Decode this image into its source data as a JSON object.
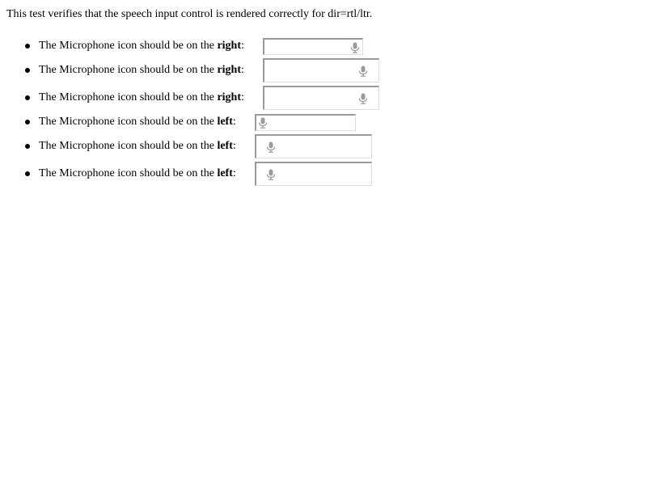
{
  "intro": "This test verifies that the speech input control is rendered correctly for dir=rtl/ltr.",
  "colors": {
    "mic_icon": "#9c9c9c",
    "field_border_dark": "#9a9a9a",
    "field_border_light": "#dedede"
  },
  "items": [
    {
      "prefix": "The Microphone icon should be on the ",
      "side": "right",
      "suffix": ":",
      "dir": "rtl",
      "value": ""
    },
    {
      "prefix": "The Microphone icon should be on the ",
      "side": "right",
      "suffix": ":",
      "dir": "rtl",
      "value": ""
    },
    {
      "prefix": "The Microphone icon should be on the ",
      "side": "right",
      "suffix": ":",
      "dir": "rtl",
      "value": ""
    },
    {
      "prefix": "The Microphone icon should be on the ",
      "side": "left",
      "suffix": ":",
      "dir": "ltr",
      "value": ""
    },
    {
      "prefix": "The Microphone icon should be on the ",
      "side": "left",
      "suffix": ":",
      "dir": "ltr",
      "value": ""
    },
    {
      "prefix": "The Microphone icon should be on the ",
      "side": "left",
      "suffix": ":",
      "dir": "ltr",
      "value": ""
    }
  ]
}
